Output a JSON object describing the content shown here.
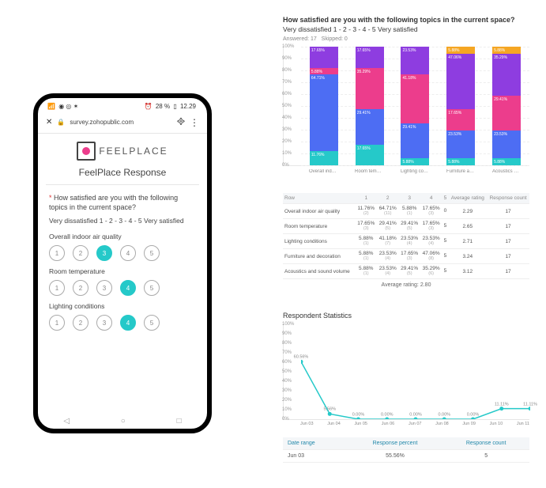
{
  "phone": {
    "status": {
      "signal": "⁴ᴳ ⬚",
      "wifi": "◉ ◎ ◌",
      "battery_text": "28 %",
      "time": "12.29",
      "alarm": "⏰"
    },
    "url_host": "survey.zohopublic.com",
    "logo_text": "FEELPLACE",
    "form_title": "FeelPlace Response",
    "question": "How satisfied are you with the following topics in the current space?",
    "scale_label": "Very dissatisfied  1 - 2 - 3 - 4 - 5 Very satisfied",
    "items": [
      {
        "label": "Overall indoor air quality",
        "selected": 3
      },
      {
        "label": "Room temperature",
        "selected": 4
      },
      {
        "label": "Lighting conditions",
        "selected": 4
      }
    ],
    "options": [
      "1",
      "2",
      "3",
      "4",
      "5"
    ]
  },
  "survey_header": {
    "title": "How satisfied are you with the following topics in the current space?",
    "subtitle": "Very dissatisfied  1 - 2 - 3 - 4 - 5 Very satisfied",
    "answered_label": "Answered:",
    "answered": "17",
    "skipped_label": "Skipped:",
    "skipped": "0"
  },
  "chart_data": {
    "type": "bar",
    "stacked": true,
    "ylabel": "",
    "xlabel": "",
    "ylim": [
      0,
      100
    ],
    "yticks": [
      0,
      10,
      20,
      30,
      40,
      50,
      60,
      70,
      80,
      90,
      100
    ],
    "categories": [
      "Overall indoor a…",
      "Room temperat…",
      "Lighting conditi…",
      "Furniture and d…",
      "Acoustics and …"
    ],
    "series_meta": [
      {
        "name": "1",
        "color": "#25c9c9"
      },
      {
        "name": "2",
        "color": "#4d6df3"
      },
      {
        "name": "3",
        "color": "#ec3d8c"
      },
      {
        "name": "4",
        "color": "#8e3de0"
      },
      {
        "name": "5",
        "color": "#f5a623"
      }
    ],
    "series": [
      {
        "name": "1",
        "values": [
          11.76,
          17.65,
          5.88,
          5.88,
          5.88
        ]
      },
      {
        "name": "2",
        "values": [
          64.71,
          29.41,
          29.41,
          23.53,
          23.53
        ]
      },
      {
        "name": "3",
        "values": [
          5.88,
          35.29,
          41.18,
          17.65,
          29.41
        ]
      },
      {
        "name": "4",
        "values": [
          17.65,
          17.65,
          23.53,
          47.06,
          35.29
        ]
      },
      {
        "name": "5",
        "values": [
          0,
          0,
          0,
          5.88,
          5.88
        ]
      }
    ]
  },
  "table": {
    "headers": [
      "Row",
      "1",
      "2",
      "3",
      "4",
      "5",
      "Average rating",
      "Response count"
    ],
    "rows": [
      {
        "label": "Overall indoor air quality",
        "cells": [
          [
            "11.76%",
            "(2)"
          ],
          [
            "64.71%",
            "(11)"
          ],
          [
            "5.88%",
            "(1)"
          ],
          [
            "17.65%",
            "(3)"
          ],
          [
            "0",
            ""
          ]
        ],
        "avg": "2.29",
        "count": "17"
      },
      {
        "label": "Room temperature",
        "cells": [
          [
            "17.65%",
            "(3)"
          ],
          [
            "29.41%",
            "(5)"
          ],
          [
            "29.41%",
            "(5)"
          ],
          [
            "17.65%",
            "(3)"
          ],
          [
            "5",
            ""
          ]
        ],
        "avg": "2.65",
        "count": "17"
      },
      {
        "label": "Lighting conditions",
        "cells": [
          [
            "5.88%",
            "(1)"
          ],
          [
            "41.18%",
            "(7)"
          ],
          [
            "23.53%",
            "(4)"
          ],
          [
            "23.53%",
            "(4)"
          ],
          [
            "5",
            ""
          ]
        ],
        "avg": "2.71",
        "count": "17"
      },
      {
        "label": "Furniture and decoration",
        "cells": [
          [
            "5.88%",
            "(1)"
          ],
          [
            "23.53%",
            "(4)"
          ],
          [
            "17.65%",
            "(3)"
          ],
          [
            "47.06%",
            "(8)"
          ],
          [
            "5",
            ""
          ]
        ],
        "avg": "3.24",
        "count": "17"
      },
      {
        "label": "Acoustics and sound volume",
        "cells": [
          [
            "5.88%",
            "(1)"
          ],
          [
            "23.53%",
            "(4)"
          ],
          [
            "29.41%",
            "(5)"
          ],
          [
            "35.29%",
            "(6)"
          ],
          [
            "5",
            ""
          ]
        ],
        "avg": "3.12",
        "count": "17"
      }
    ],
    "avg_line_label": "Average rating:",
    "avg_line_value": "2.80"
  },
  "respondent": {
    "title": "Respondent Statistics",
    "chart_data": {
      "type": "line",
      "ylim": [
        0,
        100
      ],
      "yticks": [
        0,
        10,
        20,
        30,
        40,
        50,
        60,
        70,
        80,
        90,
        100
      ],
      "x": [
        "Jun 03",
        "Jun 04",
        "Jun 05",
        "Jun 06",
        "Jun 07",
        "Jun 08",
        "Jun 09",
        "Jun 10",
        "Jun 11"
      ],
      "values": [
        60.56,
        5.56,
        0.0,
        0.0,
        0.0,
        0.0,
        0.0,
        11.11,
        11.11
      ],
      "point_labels": [
        "60.56%",
        "5.56%",
        "0.00%",
        "0.00%",
        "0.00%",
        "0.00%",
        "0.00%",
        "11.11%",
        "11.11%"
      ]
    },
    "range_table": {
      "headers": [
        "Date range",
        "Response percent",
        "Response count"
      ],
      "rows": [
        {
          "date": "Jun 03",
          "pct": "55.56%",
          "count": "5"
        }
      ]
    }
  }
}
